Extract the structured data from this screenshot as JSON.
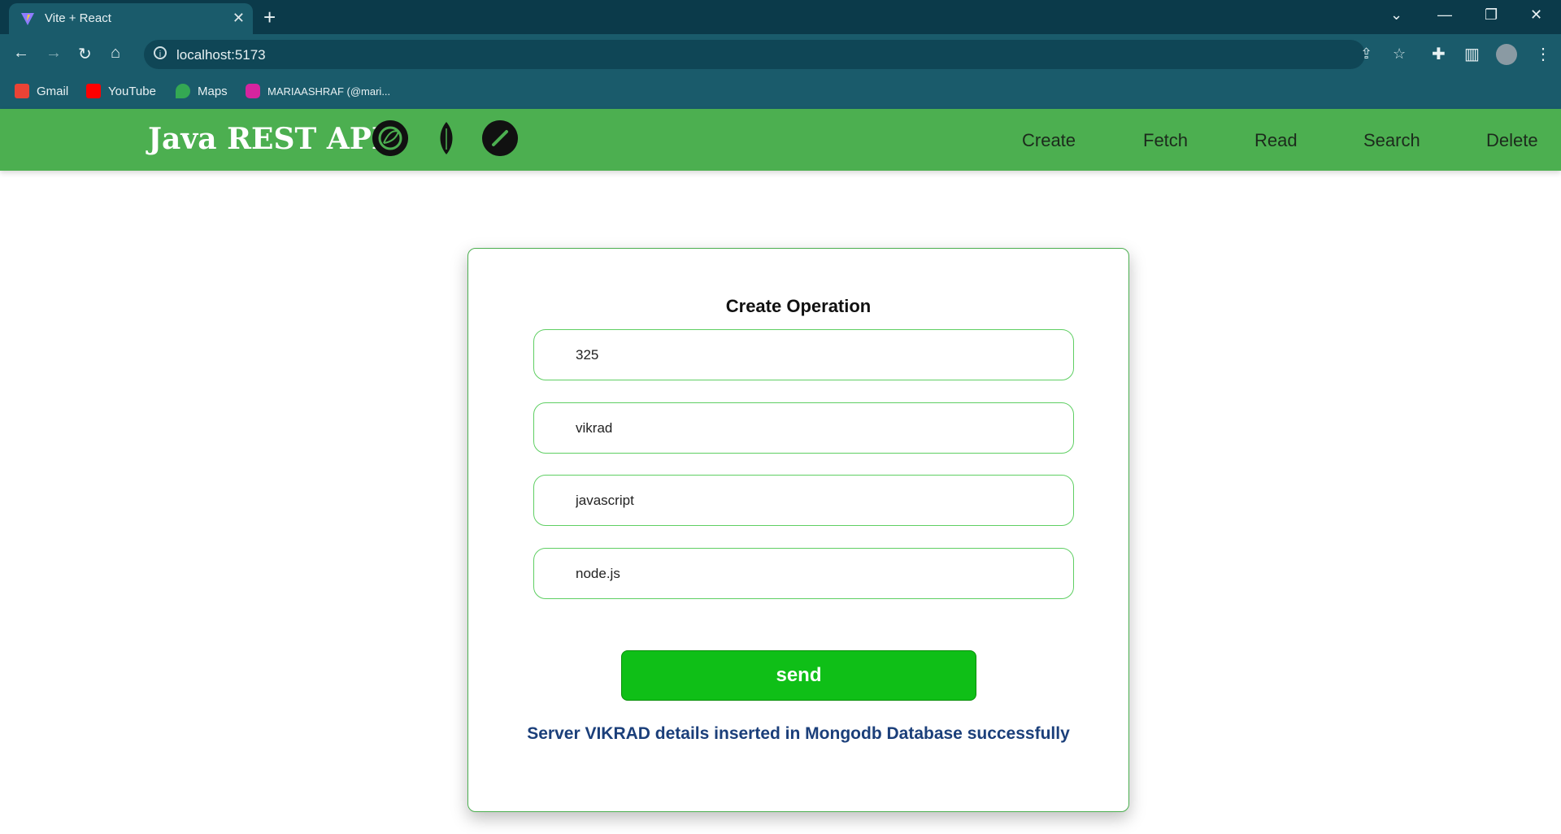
{
  "browser": {
    "tab_title": "Vite + React",
    "url": "localhost:5173",
    "bookmarks": [
      {
        "label": "Gmail",
        "icon": "gmail-icon"
      },
      {
        "label": "YouTube",
        "icon": "youtube-icon"
      },
      {
        "label": "Maps",
        "icon": "maps-icon"
      },
      {
        "label": "MARIAASHRAF (@mari...",
        "icon": "instagram-icon"
      }
    ]
  },
  "app": {
    "brand": "Java REST API",
    "nav": [
      "Create",
      "Fetch",
      "Read",
      "Search",
      "Delete"
    ],
    "form": {
      "title": "Create Operation",
      "fields": [
        "325",
        "vikrad",
        "javascript",
        "node.js"
      ],
      "button": "send",
      "status": "Server VIKRAD details inserted in Mongodb Database successfully"
    }
  },
  "colors": {
    "nav_bg": "#4caf50",
    "button_bg": "#0fbf17",
    "status_text": "#1b3f7a",
    "field_border": "#5fcf63"
  }
}
